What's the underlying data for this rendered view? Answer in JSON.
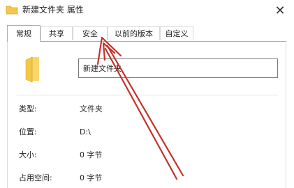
{
  "window": {
    "title": "新建文件夹 属性",
    "close_glyph": "✕"
  },
  "tabs": [
    {
      "label": "常规",
      "active": true
    },
    {
      "label": "共享",
      "active": false
    },
    {
      "label": "安全",
      "active": false
    },
    {
      "label": "以前的版本",
      "active": false
    },
    {
      "label": "自定义",
      "active": false
    }
  ],
  "general": {
    "folder_name": "新建文件夹",
    "rows": [
      {
        "label": "类型:",
        "value": "文件夹"
      },
      {
        "label": "位置:",
        "value": "D:\\"
      },
      {
        "label": "大小:",
        "value": "0 字节"
      },
      {
        "label": "占用空间:",
        "value": "0 字节"
      }
    ]
  },
  "colors": {
    "folder": "#f5c74a",
    "arrow": "#c4322a",
    "tab_border": "#adadad"
  },
  "icons": {
    "title": "folder-icon",
    "large": "folder-icon",
    "close": "close-icon"
  }
}
